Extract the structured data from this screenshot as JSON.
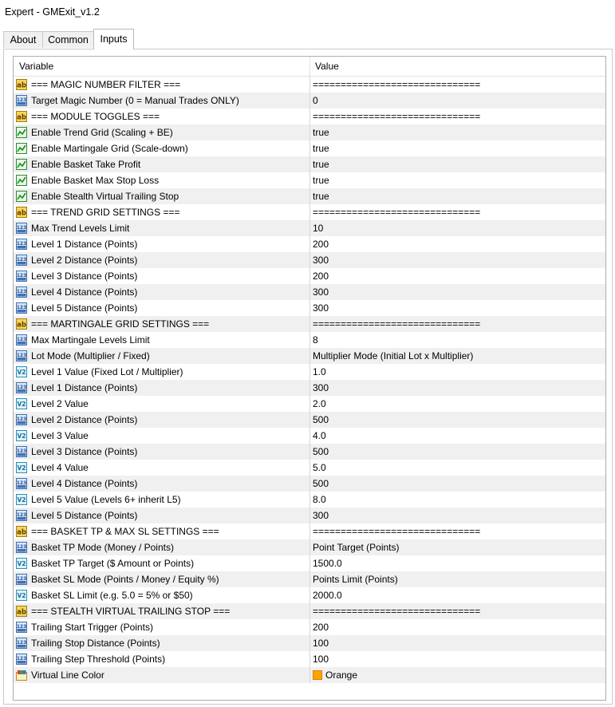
{
  "window": {
    "title": "Expert - GMExit_v1.2"
  },
  "tabs": [
    {
      "label": "About",
      "active": false
    },
    {
      "label": "Common",
      "active": false
    },
    {
      "label": "Inputs",
      "active": true
    }
  ],
  "table": {
    "headers": {
      "variable": "Variable",
      "value": "Value"
    },
    "rows": [
      {
        "icon": "string-ab-icon",
        "name": "=== MAGIC NUMBER FILTER ===",
        "value": "=============================="
      },
      {
        "icon": "integer-123-icon",
        "name": "Target Magic Number (0 = Manual Trades ONLY)",
        "value": "0"
      },
      {
        "icon": "string-ab-icon",
        "name": "=== MODULE TOGGLES ===",
        "value": "=============================="
      },
      {
        "icon": "bool-chart-icon",
        "name": "Enable Trend Grid (Scaling + BE)",
        "value": "true"
      },
      {
        "icon": "bool-chart-icon",
        "name": "Enable Martingale Grid (Scale-down)",
        "value": "true"
      },
      {
        "icon": "bool-chart-icon",
        "name": "Enable Basket Take Profit",
        "value": "true"
      },
      {
        "icon": "bool-chart-icon",
        "name": "Enable Basket Max Stop Loss",
        "value": "true"
      },
      {
        "icon": "bool-chart-icon",
        "name": "Enable Stealth Virtual Trailing Stop",
        "value": "true"
      },
      {
        "icon": "string-ab-icon",
        "name": "=== TREND GRID SETTINGS ===",
        "value": "=============================="
      },
      {
        "icon": "integer-123-icon",
        "name": "Max Trend Levels Limit",
        "value": "10"
      },
      {
        "icon": "integer-123-icon",
        "name": "Level 1 Distance (Points)",
        "value": "200"
      },
      {
        "icon": "integer-123-icon",
        "name": "Level 2 Distance (Points)",
        "value": "300"
      },
      {
        "icon": "integer-123-icon",
        "name": "Level 3 Distance (Points)",
        "value": "200"
      },
      {
        "icon": "integer-123-icon",
        "name": "Level 4 Distance (Points)",
        "value": "300"
      },
      {
        "icon": "integer-123-icon",
        "name": "Level 5 Distance (Points)",
        "value": "300"
      },
      {
        "icon": "string-ab-icon",
        "name": "=== MARTINGALE GRID SETTINGS ===",
        "value": "=============================="
      },
      {
        "icon": "integer-123-icon",
        "name": "Max Martingale Levels Limit",
        "value": "8"
      },
      {
        "icon": "integer-123-icon",
        "name": "Lot Mode (Multiplier / Fixed)",
        "value": "Multiplier Mode (Initial Lot x Multiplier)"
      },
      {
        "icon": "double-v2-icon",
        "name": "Level 1 Value (Fixed Lot / Multiplier)",
        "value": "1.0"
      },
      {
        "icon": "integer-123-icon",
        "name": "Level 1 Distance (Points)",
        "value": "300"
      },
      {
        "icon": "double-v2-icon",
        "name": "Level 2 Value",
        "value": "2.0"
      },
      {
        "icon": "integer-123-icon",
        "name": "Level 2 Distance (Points)",
        "value": "500"
      },
      {
        "icon": "double-v2-icon",
        "name": "Level 3 Value",
        "value": "4.0"
      },
      {
        "icon": "integer-123-icon",
        "name": "Level 3 Distance (Points)",
        "value": "500"
      },
      {
        "icon": "double-v2-icon",
        "name": "Level 4 Value",
        "value": "5.0"
      },
      {
        "icon": "integer-123-icon",
        "name": "Level 4 Distance (Points)",
        "value": "500"
      },
      {
        "icon": "double-v2-icon",
        "name": "Level 5 Value (Levels 6+ inherit L5)",
        "value": "8.0"
      },
      {
        "icon": "integer-123-icon",
        "name": "Level 5 Distance (Points)",
        "value": "300"
      },
      {
        "icon": "string-ab-icon",
        "name": "=== BASKET TP & MAX SL SETTINGS ===",
        "value": "=============================="
      },
      {
        "icon": "integer-123-icon",
        "name": "Basket TP Mode (Money / Points)",
        "value": "Point Target (Points)"
      },
      {
        "icon": "double-v2-icon",
        "name": "Basket TP Target ($ Amount or Points)",
        "value": "1500.0"
      },
      {
        "icon": "integer-123-icon",
        "name": "Basket SL Mode (Points / Money / Equity %)",
        "value": "Points Limit (Points)"
      },
      {
        "icon": "double-v2-icon",
        "name": "Basket SL Limit (e.g. 5.0 = 5% or $50)",
        "value": "2000.0"
      },
      {
        "icon": "string-ab-icon",
        "name": "=== STEALTH VIRTUAL TRAILING STOP ===",
        "value": "=============================="
      },
      {
        "icon": "integer-123-icon",
        "name": "Trailing Start Trigger (Points)",
        "value": "200"
      },
      {
        "icon": "integer-123-icon",
        "name": "Trailing Stop Distance (Points)",
        "value": "100"
      },
      {
        "icon": "integer-123-icon",
        "name": "Trailing Step Threshold (Points)",
        "value": "100"
      },
      {
        "icon": "color-palette-icon",
        "name": "Virtual Line Color",
        "value": "Orange",
        "swatch": "#ffa500"
      }
    ]
  }
}
